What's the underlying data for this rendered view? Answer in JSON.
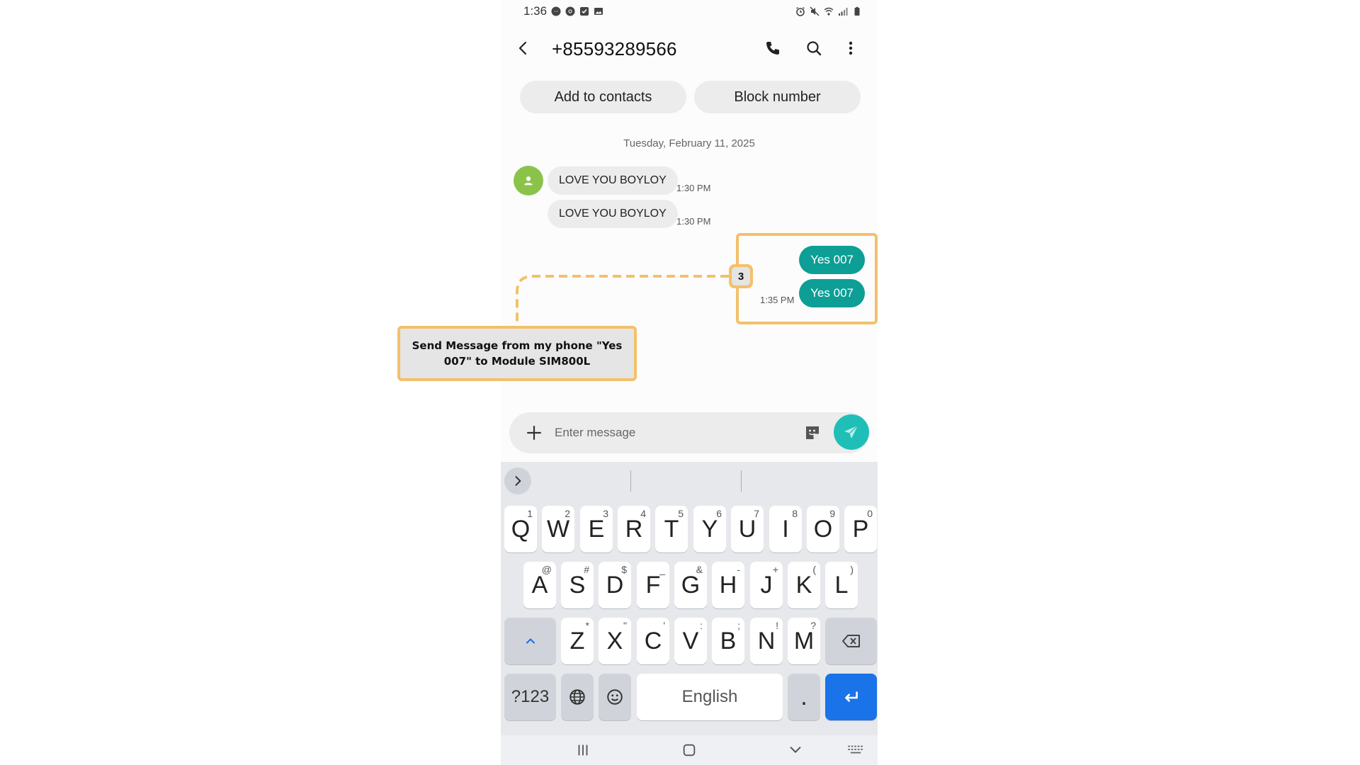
{
  "statusbar": {
    "time": "1:36",
    "left_icons": [
      "messenger-icon",
      "chrome-icon",
      "checkbox-icon",
      "gallery-icon"
    ],
    "right_icons": [
      "alarm-icon",
      "mute-icon",
      "wifi-icon",
      "signal-icon",
      "battery-icon"
    ]
  },
  "appbar": {
    "title": "+85593289566",
    "icons": [
      "back-icon",
      "call-icon",
      "search-icon",
      "more-icon"
    ]
  },
  "actions": {
    "add_contacts": "Add to contacts",
    "block_number": "Block number"
  },
  "conversation": {
    "date": "Tuesday, February 11, 2025",
    "incoming": [
      {
        "text": "LOVE YOU BOYLOY",
        "time": "1:30 PM"
      },
      {
        "text": "LOVE YOU BOYLOY",
        "time": "1:30 PM"
      }
    ],
    "outgoing": [
      {
        "text": "Yes 007"
      },
      {
        "text": "Yes 007",
        "time": "1:35 PM"
      }
    ],
    "accent_color": "#0d9e95"
  },
  "compose": {
    "placeholder": "Enter message"
  },
  "keyboard": {
    "row1": [
      {
        "key": "Q",
        "hint": "1"
      },
      {
        "key": "W",
        "hint": "2"
      },
      {
        "key": "E",
        "hint": "3"
      },
      {
        "key": "R",
        "hint": "4"
      },
      {
        "key": "T",
        "hint": "5"
      },
      {
        "key": "Y",
        "hint": "6"
      },
      {
        "key": "U",
        "hint": "7"
      },
      {
        "key": "I",
        "hint": "8"
      },
      {
        "key": "O",
        "hint": "9"
      },
      {
        "key": "P",
        "hint": "0"
      }
    ],
    "row2": [
      {
        "key": "A",
        "hint": "@"
      },
      {
        "key": "S",
        "hint": "#"
      },
      {
        "key": "D",
        "hint": "$"
      },
      {
        "key": "F",
        "hint": "_"
      },
      {
        "key": "G",
        "hint": "&"
      },
      {
        "key": "H",
        "hint": "-"
      },
      {
        "key": "J",
        "hint": "+"
      },
      {
        "key": "K",
        "hint": "("
      },
      {
        "key": "L",
        "hint": ")"
      }
    ],
    "row3": [
      {
        "key": "Z",
        "hint": "*"
      },
      {
        "key": "X",
        "hint": "\""
      },
      {
        "key": "C",
        "hint": "'"
      },
      {
        "key": "V",
        "hint": ":"
      },
      {
        "key": "B",
        "hint": ";"
      },
      {
        "key": "N",
        "hint": "!"
      },
      {
        "key": "M",
        "hint": "?"
      }
    ],
    "symbols_label": "?123",
    "space_label": "English",
    "period_label": "."
  },
  "annotation": {
    "badge": "3",
    "callout": "Send Message from my phone \"Yes 007\" to Module SIM800L",
    "highlight_color": "#f4c06a"
  }
}
